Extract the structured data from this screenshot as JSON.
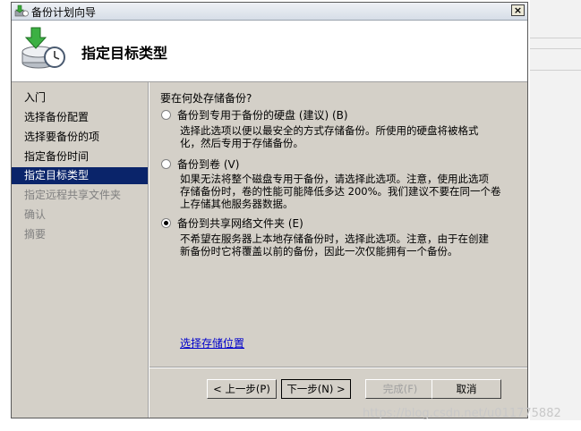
{
  "window": {
    "title": "备份计划向导",
    "close_glyph": "×"
  },
  "header": {
    "title": "指定目标类型",
    "icon": "backup-wizard-icon"
  },
  "nav": {
    "items": [
      {
        "label": "入门",
        "state": "normal"
      },
      {
        "label": "选择备份配置",
        "state": "normal"
      },
      {
        "label": "选择要备份的项",
        "state": "normal"
      },
      {
        "label": "指定备份时间",
        "state": "normal"
      },
      {
        "label": "指定目标类型",
        "state": "selected"
      },
      {
        "label": "指定远程共享文件夹",
        "state": "disabled"
      },
      {
        "label": "确认",
        "state": "disabled"
      },
      {
        "label": "摘要",
        "state": "disabled"
      }
    ]
  },
  "content": {
    "question": "要在何处存储备份?",
    "options": [
      {
        "label": "备份到专用于备份的硬盘 (建议) (B)",
        "desc1": "选择此选项以便以最安全的方式存储备份。所使用的硬盘将被格式",
        "desc2": "化，然后专用于存储备份。",
        "checked": false
      },
      {
        "label": "备份到卷 (V)",
        "desc1": "如果无法将整个磁盘专用于备份，请选择此选项。注意，使用此选项",
        "desc2": "存储备份时，卷的性能可能降低多达 200%。我们建议不要在同一个卷",
        "desc3": "上存储其他服务器数据。",
        "checked": false
      },
      {
        "label": "备份到共享网络文件夹 (E)",
        "desc1": "不希望在服务器上本地存储备份时，选择此选项。注意，由于在创建",
        "desc2": "新备份时它将覆盖以前的备份，因此一次仅能拥有一个备份。",
        "checked": true
      }
    ],
    "link": "选择存储位置"
  },
  "buttons": {
    "back": "< 上一步(P)",
    "next": "下一步(N) >",
    "finish": "完成(F)",
    "cancel": "取消"
  },
  "watermark": "https://blog.csdn.net/u011775882"
}
